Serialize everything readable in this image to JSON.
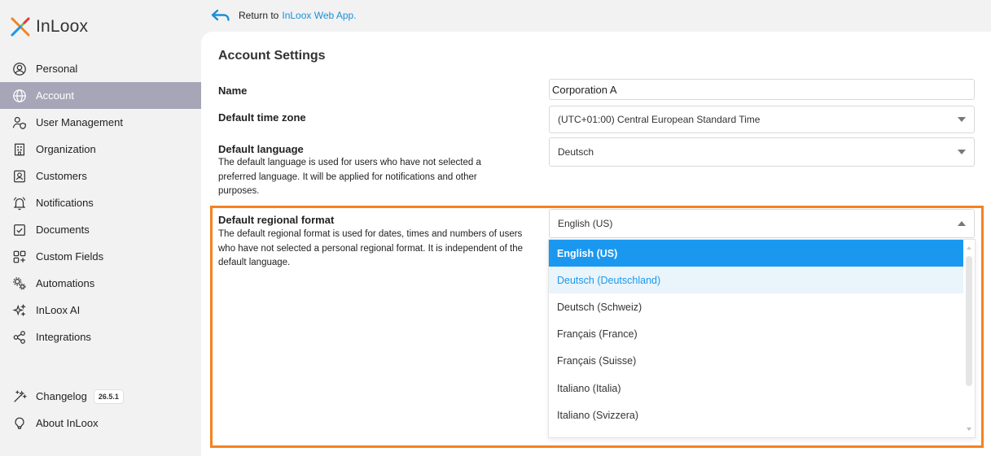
{
  "brand": {
    "name": "InLoox"
  },
  "topbar": {
    "return_text": "Return to",
    "link_text": "InLoox Web App."
  },
  "sidebar": {
    "items": [
      {
        "label": "Personal",
        "icon": "user-circle-icon"
      },
      {
        "label": "Account",
        "icon": "globe-icon",
        "active": true
      },
      {
        "label": "User Management",
        "icon": "user-shield-icon"
      },
      {
        "label": "Organization",
        "icon": "building-icon"
      },
      {
        "label": "Customers",
        "icon": "contact-card-icon"
      },
      {
        "label": "Notifications",
        "icon": "bell-icon"
      },
      {
        "label": "Documents",
        "icon": "document-check-icon"
      },
      {
        "label": "Custom Fields",
        "icon": "grid-plus-icon"
      },
      {
        "label": "Automations",
        "icon": "gears-icon"
      },
      {
        "label": "InLoox AI",
        "icon": "sparkle-icon"
      },
      {
        "label": "Integrations",
        "icon": "share-nodes-icon"
      }
    ],
    "bottom": [
      {
        "label": "Changelog",
        "icon": "magic-wand-icon",
        "badge": "26.5.1"
      },
      {
        "label": "About InLoox",
        "icon": "lightbulb-icon"
      }
    ]
  },
  "main": {
    "title": "Account Settings",
    "name": {
      "label": "Name",
      "value": "Corporation A"
    },
    "timezone": {
      "label": "Default time zone",
      "value": "(UTC+01:00) Central European Standard Time"
    },
    "language": {
      "label": "Default language",
      "description": "The default language is used for users who have not selected a preferred language. It will be applied for notifications and other purposes.",
      "value": "Deutsch"
    },
    "regional": {
      "label": "Default regional format",
      "description": "The default regional format is used for dates, times and numbers of users who have not selected a personal regional format. It is independent of the default language.",
      "value": "English (US)",
      "options": [
        "English (US)",
        "Deutsch (Deutschland)",
        "Deutsch (Schweiz)",
        "Français (France)",
        "Français (Suisse)",
        "Italiano (Italia)",
        "Italiano (Svizzera)"
      ]
    }
  },
  "colors": {
    "accent": "#1a98f0",
    "highlight": "#f58220",
    "active_nav": "#a6a6b8"
  }
}
